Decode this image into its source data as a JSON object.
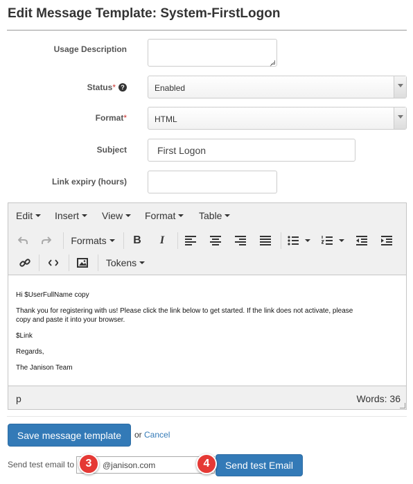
{
  "page": {
    "title": "Edit Message Template: System-FirstLogon"
  },
  "form": {
    "usage_description": {
      "label": "Usage Description",
      "value": ""
    },
    "status": {
      "label": "Status",
      "required": "*",
      "value": "Enabled"
    },
    "format": {
      "label": "Format",
      "required": "*",
      "value": "HTML"
    },
    "subject": {
      "label": "Subject",
      "value": "First Logon"
    },
    "link_expiry": {
      "label": "Link expiry (hours)",
      "value": ""
    }
  },
  "editor": {
    "menus": [
      "Edit",
      "Insert",
      "View",
      "Format",
      "Table"
    ],
    "toolbar": {
      "formats_label": "Formats",
      "tokens_label": "Tokens"
    },
    "content": {
      "line1": "Hi $UserFullName copy",
      "line2a": "Thank you for registering with us!  Please click the link below to get started. If the link does not activate, please",
      "line2b": "copy and paste it into your browser.",
      "line3": "$Link",
      "line4": "Regards,",
      "line5": "The Janison Team"
    },
    "status": {
      "path": "p",
      "word_count": "Words: 36"
    }
  },
  "actions": {
    "save_label": "Save message template",
    "or_text": "or",
    "cancel_label": "Cancel",
    "test_email_label": "Send test email to",
    "test_email_value": "@janison.com",
    "send_test_label": "Send test Email"
  },
  "callouts": {
    "first": "3",
    "second": "4"
  },
  "colors": {
    "primary": "#337ab7",
    "callout": "#e53935",
    "required": "#c9302c"
  }
}
